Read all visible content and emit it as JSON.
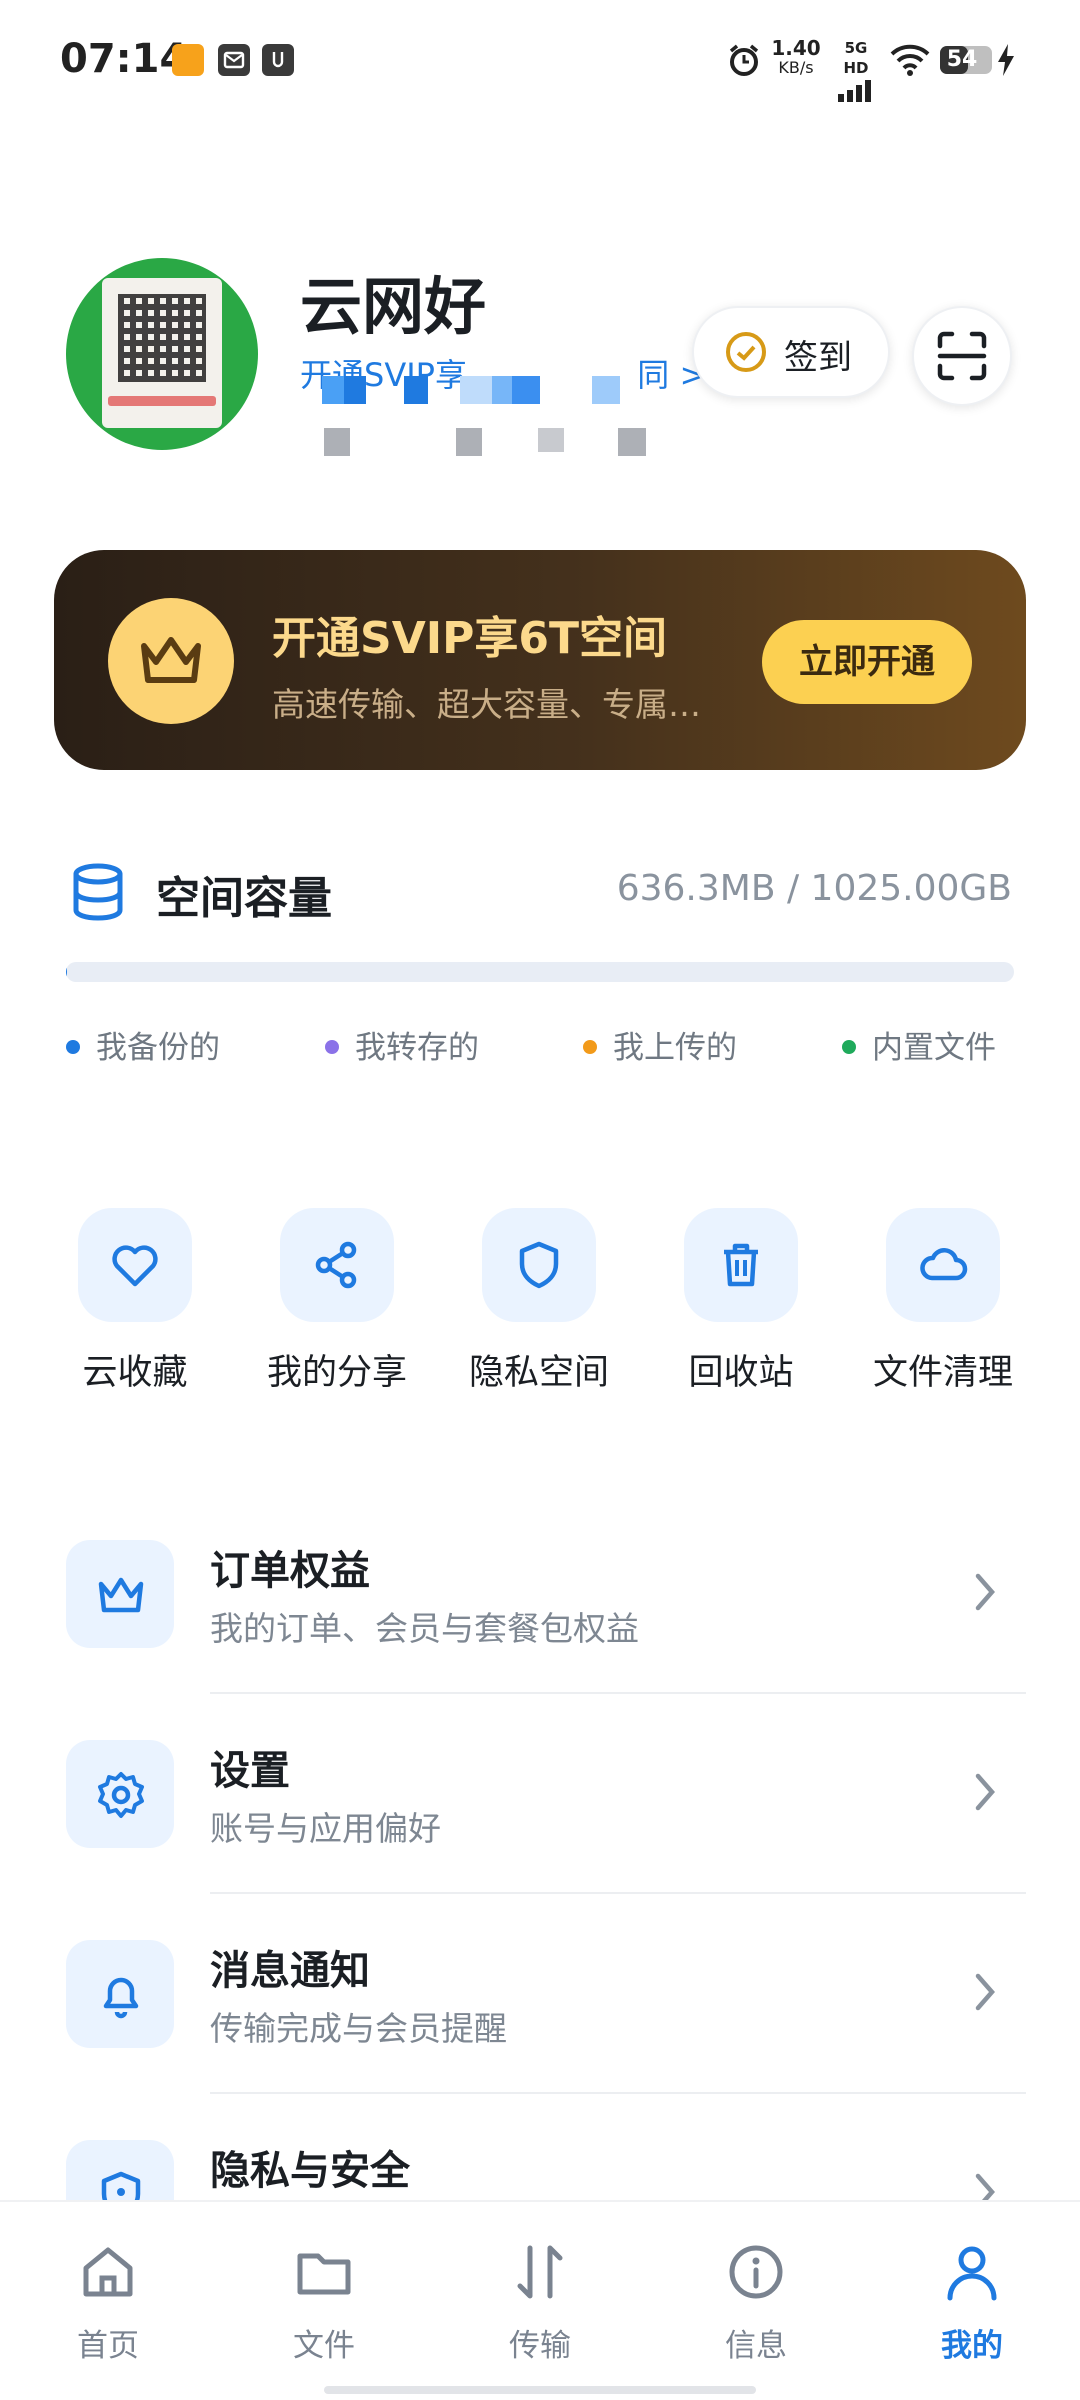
{
  "status_bar": {
    "time": "07:14",
    "net_speed_value": "1.40",
    "net_speed_unit": "KB/s",
    "network": "5G HD",
    "battery": "54",
    "battery_level": 0.54
  },
  "profile": {
    "username": "云网好",
    "svip_link": "开通SVIP享",
    "svip_link_end": "同 >",
    "checkin_label": "签到"
  },
  "banner": {
    "title": "开通SVIP享6T空间",
    "subtitle": "高速传输、超大容量、专属…",
    "button": "立即开通",
    "colors": {
      "accent": "#fcd051",
      "title": "#fcd98c"
    }
  },
  "storage": {
    "title": "空间容量",
    "usage": "636.3MB / 1025.00GB",
    "used_fraction": 0.0006,
    "legend": [
      {
        "label": "我备份的",
        "color": "#1f7ae0"
      },
      {
        "label": "我转存的",
        "color": "#8b72e8"
      },
      {
        "label": "我上传的",
        "color": "#f29a1a"
      },
      {
        "label": "内置文件",
        "color": "#1faa5b"
      }
    ]
  },
  "quick_actions": [
    {
      "label": "云收藏",
      "icon": "heart-icon"
    },
    {
      "label": "我的分享",
      "icon": "share-icon"
    },
    {
      "label": "隐私空间",
      "icon": "shield-icon"
    },
    {
      "label": "回收站",
      "icon": "trash-icon"
    },
    {
      "label": "文件清理",
      "icon": "cloud-icon"
    }
  ],
  "menu": [
    {
      "title": "订单权益",
      "subtitle": "我的订单、会员与套餐包权益",
      "icon": "crown-icon"
    },
    {
      "title": "设置",
      "subtitle": "账号与应用偏好",
      "icon": "gear-icon"
    },
    {
      "title": "消息通知",
      "subtitle": "传输完成与会员提醒",
      "icon": "bell-icon"
    },
    {
      "title": "隐私与安全",
      "subtitle": "",
      "icon": "lock-shield-icon"
    }
  ],
  "bottom_nav": [
    {
      "label": "首页",
      "icon": "home-icon",
      "active": false
    },
    {
      "label": "文件",
      "icon": "folder-icon",
      "active": false
    },
    {
      "label": "传输",
      "icon": "transfer-icon",
      "active": false
    },
    {
      "label": "信息",
      "icon": "info-icon",
      "active": false
    },
    {
      "label": "我的",
      "icon": "user-icon",
      "active": true
    }
  ]
}
